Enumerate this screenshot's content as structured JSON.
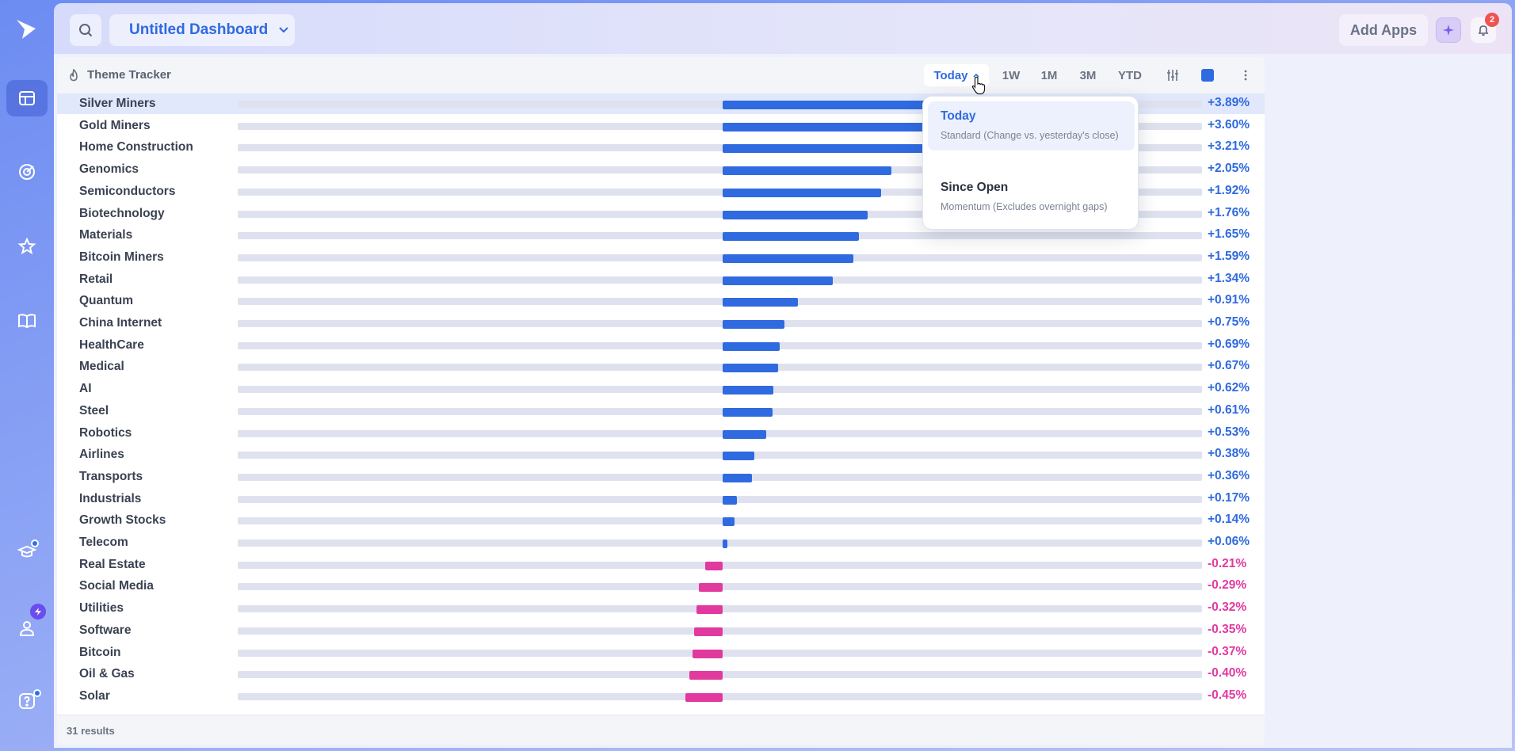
{
  "header": {
    "dashboard_title": "Untitled Dashboard",
    "add_apps_label": "Add Apps",
    "notifications_count": "2"
  },
  "widget": {
    "title": "Theme Tracker",
    "timeframes": [
      "Today",
      "1W",
      "1M",
      "3M",
      "YTD"
    ],
    "active_timeframe": "Today",
    "results_label": "31 results"
  },
  "dropdown": {
    "options": [
      {
        "label": "Today",
        "description": "Standard (Change vs. yesterday's close)",
        "selected": true
      },
      {
        "label": "Since Open",
        "description": "Momentum (Excludes overnight gaps)",
        "selected": false
      }
    ]
  },
  "colors": {
    "positive": "#2f6ae0",
    "negative": "#e2399f",
    "accent": "#2f6ae0"
  },
  "chart_data": {
    "type": "bar",
    "orientation": "horizontal",
    "units": "percent change",
    "xlim": [
      -5,
      5
    ],
    "rows": [
      {
        "name": "Silver Miners",
        "value": 3.89,
        "label": "+3.89%",
        "highlighted": true
      },
      {
        "name": "Gold Miners",
        "value": 3.6,
        "label": "+3.60%"
      },
      {
        "name": "Home Construction",
        "value": 3.21,
        "label": "+3.21%"
      },
      {
        "name": "Genomics",
        "value": 2.05,
        "label": "+2.05%"
      },
      {
        "name": "Semiconductors",
        "value": 1.92,
        "label": "+1.92%"
      },
      {
        "name": "Biotechnology",
        "value": 1.76,
        "label": "+1.76%"
      },
      {
        "name": "Materials",
        "value": 1.65,
        "label": "+1.65%"
      },
      {
        "name": "Bitcoin Miners",
        "value": 1.59,
        "label": "+1.59%"
      },
      {
        "name": "Retail",
        "value": 1.34,
        "label": "+1.34%"
      },
      {
        "name": "Quantum",
        "value": 0.91,
        "label": "+0.91%"
      },
      {
        "name": "China Internet",
        "value": 0.75,
        "label": "+0.75%"
      },
      {
        "name": "HealthCare",
        "value": 0.69,
        "label": "+0.69%"
      },
      {
        "name": "Medical",
        "value": 0.67,
        "label": "+0.67%"
      },
      {
        "name": "AI",
        "value": 0.62,
        "label": "+0.62%"
      },
      {
        "name": "Steel",
        "value": 0.61,
        "label": "+0.61%"
      },
      {
        "name": "Robotics",
        "value": 0.53,
        "label": "+0.53%"
      },
      {
        "name": "Airlines",
        "value": 0.38,
        "label": "+0.38%"
      },
      {
        "name": "Transports",
        "value": 0.36,
        "label": "+0.36%"
      },
      {
        "name": "Industrials",
        "value": 0.17,
        "label": "+0.17%"
      },
      {
        "name": "Growth Stocks",
        "value": 0.14,
        "label": "+0.14%"
      },
      {
        "name": "Telecom",
        "value": 0.06,
        "label": "+0.06%"
      },
      {
        "name": "Real Estate",
        "value": -0.21,
        "label": "-0.21%"
      },
      {
        "name": "Social Media",
        "value": -0.29,
        "label": "-0.29%"
      },
      {
        "name": "Utilities",
        "value": -0.32,
        "label": "-0.32%"
      },
      {
        "name": "Software",
        "value": -0.35,
        "label": "-0.35%"
      },
      {
        "name": "Bitcoin",
        "value": -0.37,
        "label": "-0.37%"
      },
      {
        "name": "Oil & Gas",
        "value": -0.4,
        "label": "-0.40%"
      },
      {
        "name": "Solar",
        "value": -0.45,
        "label": "-0.45%"
      }
    ]
  }
}
